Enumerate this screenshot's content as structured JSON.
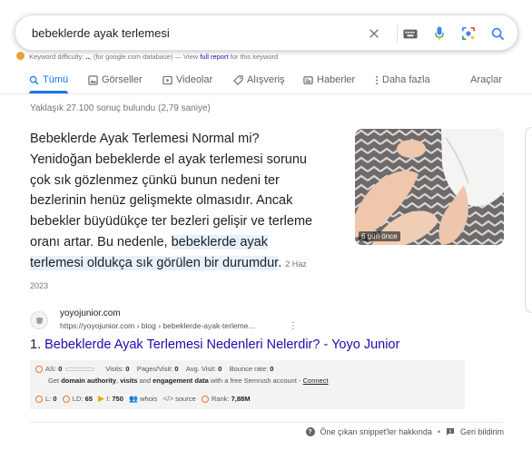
{
  "search": {
    "query": "bebeklerde ayak terlemesi"
  },
  "keyword_bar": {
    "prefix": "Keyword difficulty:",
    "value": "..",
    "middle": "(for google.com database) — View",
    "link": "full report",
    "suffix": "for this keyword"
  },
  "tabs": [
    {
      "label": "Tümü",
      "icon": "search-icon",
      "active": true
    },
    {
      "label": "Görseller",
      "icon": "image-icon",
      "active": false
    },
    {
      "label": "Videolar",
      "icon": "video-icon",
      "active": false
    },
    {
      "label": "Alışveriş",
      "icon": "tag-icon",
      "active": false
    },
    {
      "label": "Haberler",
      "icon": "news-icon",
      "active": false
    },
    {
      "label": "Daha fazla",
      "icon": "more-vert-icon",
      "active": false
    }
  ],
  "tools_label": "Araçlar",
  "stats": "Yaklaşık 27.100 sonuç bulundu (2,79 saniye)",
  "snippet": {
    "text_plain": "Bebeklerde Ayak Terlemesi Normal mi? Yenidoğan bebeklerde el ayak terlemesi sorunu çok sık gözlenmez çünkü bunun nedeni ter bezlerinin henüz gelişmekte olmasıdır. Ancak bebekler büyüdükçe ter bezleri gelişir ve terleme oranı artar. Bu nedenle, ",
    "text_highlight": "bebeklerde ayak terlemesi oldukça sık görülen bir durumdur",
    "text_end": ".",
    "date": "2 Haz 2023",
    "image_label": "6 gün önce"
  },
  "source": {
    "site_name": "yoyojunior.com",
    "url": "https://yoyojunior.com › blog › bebeklerde-ayak-terleme...",
    "more": "⋮"
  },
  "result": {
    "number": "1.",
    "title": "Bebeklerde Ayak Terlemesi Nedenleri Nelerdir? - Yoyo Junior"
  },
  "semrush": {
    "as_label": "AS:",
    "as_value": "0",
    "visits_label": "Visits:",
    "visits_value": "0",
    "pv_label": "Pages/Visit:",
    "pv_value": "0",
    "avg_label": "Avg. Visit:",
    "avg_value": "0",
    "bounce_label": "Bounce rate:",
    "bounce_value": "0",
    "cta_prefix": "Get",
    "cta_bold1": "domain authority",
    "cta_sep": ",",
    "cta_bold2": "visits",
    "cta_and": "and",
    "cta_bold3": "engagement data",
    "cta_mid": "with a free Semrush account -",
    "cta_link": "Connect",
    "l_label": "L:",
    "l_value": "0",
    "ld_label": "LD:",
    "ld_value": "65",
    "i_label": "I:",
    "i_value": "750",
    "whois": "whois",
    "source": "source",
    "rank_label": "Rank:",
    "rank_value": "7,88M"
  },
  "footer": {
    "about": "Öne çıkan snippet'ler hakkında",
    "sep": "•",
    "feedback": "Geri bildirim"
  },
  "colors": {
    "accent": "#1a73e8",
    "link": "#1a0dab",
    "highlight": "#e8f0fe",
    "semrush_orange": "#e07a3b"
  }
}
